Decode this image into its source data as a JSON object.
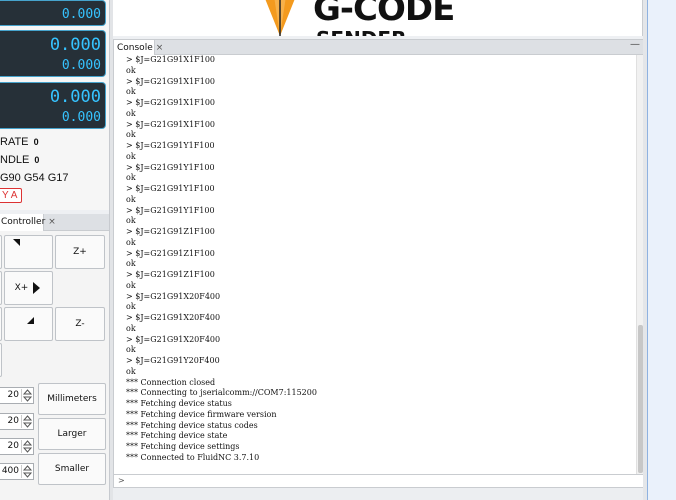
{
  "dro": {
    "row1_sub": "0.000",
    "row2_main": "0.000",
    "row2_sub": "0.000",
    "row3_main": "0.000",
    "row3_sub": "0.000",
    "feed_label": "RATE",
    "feed_value": "0",
    "spindle_label": "NDLE",
    "spindle_value": "0",
    "gcode_state": "G90 G54 G17",
    "alarm_badge": "Y A"
  },
  "controller": {
    "tab_label": "Controller",
    "tab_close": "×",
    "z_plus": "Z+",
    "x_plus": "X+",
    "z_minus": "Z-",
    "step_values": [
      "20",
      "20",
      "20",
      "400"
    ],
    "units_button": "Millimeters",
    "larger_button": "Larger",
    "smaller_button": "Smaller"
  },
  "logo": {
    "word_line1": "G-CODE",
    "word_line2": "SENDER"
  },
  "console": {
    "tab_label": "Console",
    "tab_close": "×",
    "minimize": "—",
    "lines": [
      "> $J=G21G91X1F100",
      "ok",
      "> $J=G21G91X1F100",
      "ok",
      "> $J=G21G91X1F100",
      "ok",
      "> $J=G21G91X1F100",
      "ok",
      "> $J=G21G91Y1F100",
      "ok",
      "> $J=G21G91Y1F100",
      "ok",
      "> $J=G21G91Y1F100",
      "ok",
      "> $J=G21G91Y1F100",
      "ok",
      "> $J=G21G91Z1F100",
      "ok",
      "> $J=G21G91Z1F100",
      "ok",
      "> $J=G21G91Z1F100",
      "ok",
      "> $J=G21G91X20F400",
      "ok",
      "> $J=G21G91X20F400",
      "ok",
      "> $J=G21G91X20F400",
      "ok",
      "> $J=G21G91Y20F400",
      "ok",
      "*** Connection closed",
      "*** Connecting to jserialcomm://COM7:115200",
      "*** Fetching device status",
      "*** Fetching device firmware version",
      "*** Fetching device status codes",
      "*** Fetching device state",
      "*** Fetching device settings",
      "*** Connected to FluidNC 3.7.10"
    ],
    "input_prompt": ">"
  },
  "colors": {
    "dro_background": "#263038",
    "dro_text": "#36c3ff",
    "alarm": "#dd3333",
    "logo_orange": "#f39a1e"
  },
  "icons": {
    "jog_diagonal": "arrow-triangle-icon",
    "jog_x_plus": "play-triangle-icon",
    "spinner": "up-down-arrows-icon"
  }
}
